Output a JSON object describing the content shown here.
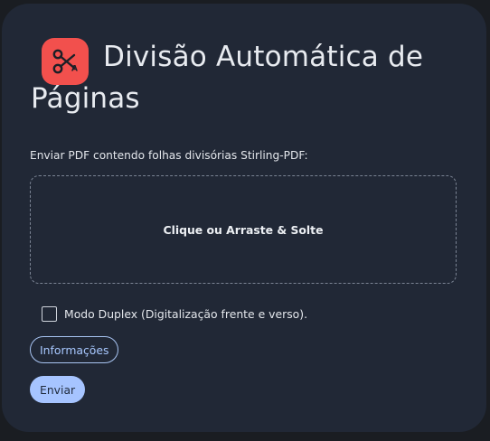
{
  "header": {
    "icon": "scissors-pdf-icon",
    "title": "Divisão Automática de Páginas"
  },
  "upload": {
    "label": "Enviar PDF contendo folhas divisórias Stirling-PDF:",
    "dropzone_text": "Clique ou Arraste & Solte"
  },
  "options": {
    "duplex_label": "Modo Duplex (Digitalização frente e verso).",
    "duplex_checked": false
  },
  "buttons": {
    "info_label": "Informações",
    "submit_label": "Enviar"
  },
  "colors": {
    "card_bg": "#212836",
    "icon_bg": "#f2504d",
    "accent": "#a6c4ff"
  }
}
